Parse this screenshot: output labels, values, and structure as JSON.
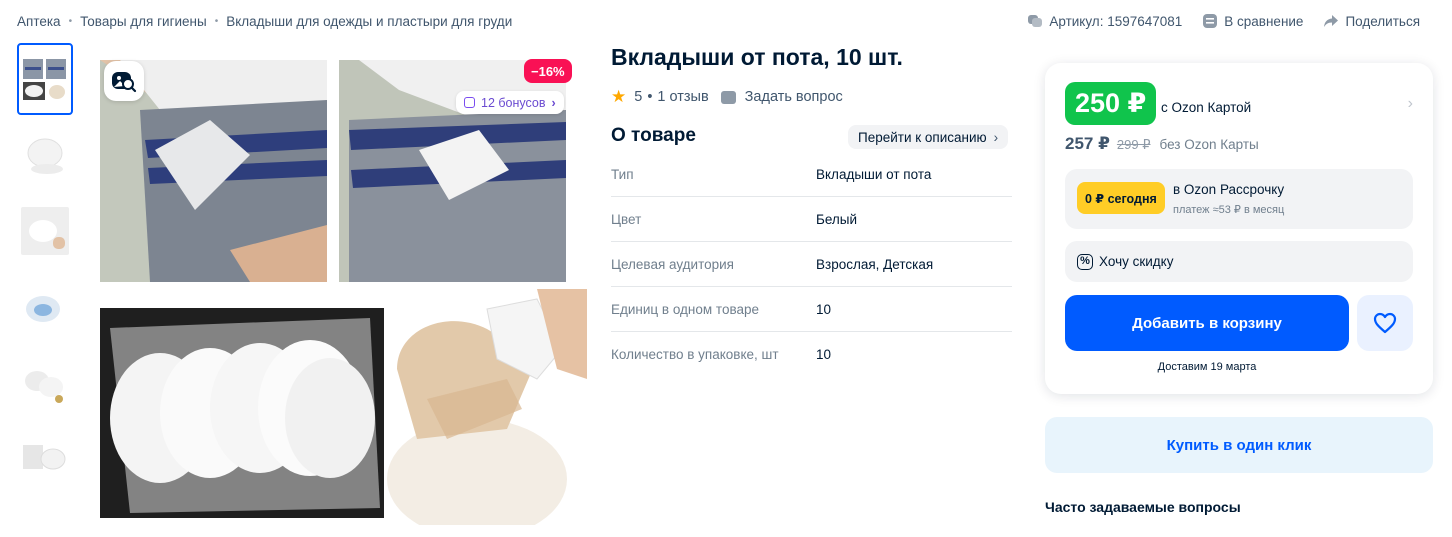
{
  "breadcrumb": [
    "Аптека",
    "Товары для гигиены",
    "Вкладыши для одежды и пластыри для груди"
  ],
  "breadcrumb_sep": "•",
  "toplinks": {
    "article": "Артикул: 1597647081",
    "compare": "В сравнение",
    "share": "Поделиться"
  },
  "gallery": {
    "discount": "−16%",
    "bonus": "12 бонусов",
    "thumbnail_count": 6
  },
  "product": {
    "title": "Вкладыши от пота, 10 шт.",
    "rating": "5",
    "reviews": "1 отзыв",
    "rating_dot": "•",
    "ask": "Задать вопрос"
  },
  "about": {
    "heading": "О товаре",
    "goto": "Перейти к описанию",
    "specs": [
      {
        "k": "Тип",
        "v": "Вкладыши от пота"
      },
      {
        "k": "Цвет",
        "v": "Белый"
      },
      {
        "k": "Целевая аудитория",
        "v": "Взрослая, Детская"
      },
      {
        "k": "Единиц в одном товаре",
        "v": "10"
      },
      {
        "k": "Количество в упаковке, шт",
        "v": "10"
      }
    ]
  },
  "buy": {
    "price_card": "250 ₽",
    "with_card": "с Ozon Картой",
    "price": "257 ₽",
    "old_price": "299 ₽",
    "no_card": "без Ozon Карты",
    "install_badge": "0 ₽ сегодня",
    "install_line1": "в Ozon Рассрочку",
    "install_line2": "платеж ≈53 ₽ в месяц",
    "want_discount": "Хочу скидку",
    "add_to_cart": "Добавить в корзину",
    "delivery": "Доставим 19 марта",
    "one_click": "Купить в один клик"
  },
  "faq": {
    "heading": "Часто задаваемые вопросы"
  },
  "colors": {
    "accent": "#005bff",
    "price_green": "#10c44c",
    "discount_pink": "#f91155",
    "install_yellow": "#ffcd26"
  }
}
